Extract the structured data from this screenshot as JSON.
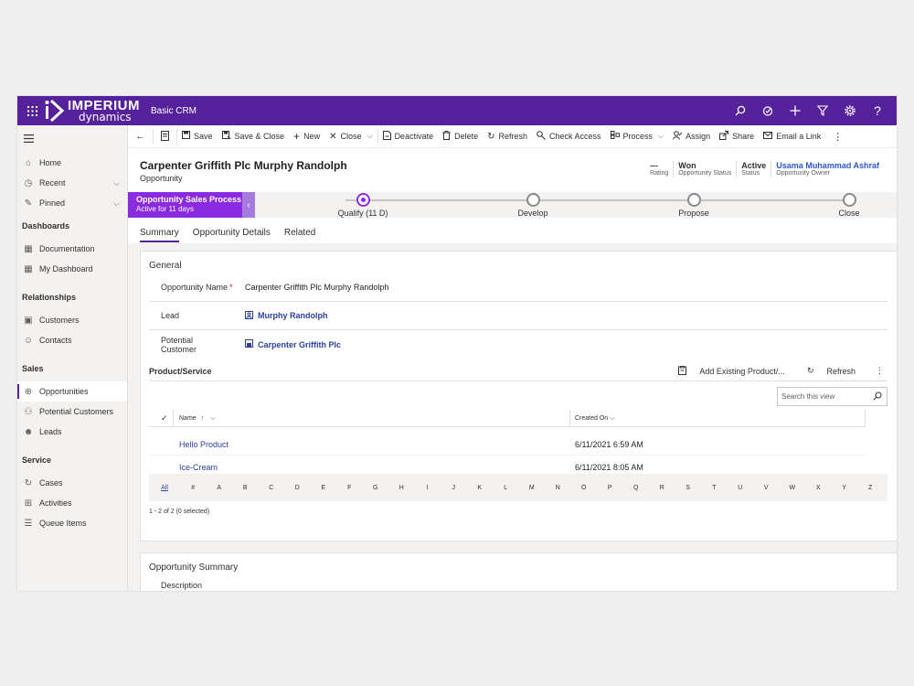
{
  "topbar": {
    "logo_line1": "IMPERIUM",
    "logo_line2": "dynamics",
    "app_name": "Basic CRM",
    "icons": [
      "search-icon",
      "task-icon",
      "plus-icon",
      "filter-icon",
      "gear-icon",
      "help-icon"
    ],
    "help_glyph": "?"
  },
  "sidebar": {
    "home": "Home",
    "recent": "Recent",
    "pinned": "Pinned",
    "sections": {
      "dashboards": "Dashboards",
      "relationships": "Relationships",
      "sales": "Sales",
      "service": "Service"
    },
    "dashboards_items": [
      "Documentation",
      "My Dashboard"
    ],
    "relationships_items": [
      "Customers",
      "Contacts"
    ],
    "sales_items": [
      "Opportunities",
      "Potential Customers",
      "Leads"
    ],
    "service_items": [
      "Cases",
      "Activities",
      "Queue Items"
    ]
  },
  "commands": {
    "save": "Save",
    "save_close": "Save & Close",
    "new": "New",
    "close": "Close",
    "deactivate": "Deactivate",
    "delete": "Delete",
    "refresh": "Refresh",
    "check_access": "Check Access",
    "process": "Process",
    "assign": "Assign",
    "share": "Share",
    "email_link": "Email a Link"
  },
  "record": {
    "title": "Carpenter Griffith Plc Murphy Randolph",
    "entity": "Opportunity",
    "header_fields": [
      {
        "value": "---",
        "label": "Rating"
      },
      {
        "value": "Won",
        "label": "Opportunity Status"
      },
      {
        "value": "Active",
        "label": "Status"
      },
      {
        "value": "Usama Muhammad Ashraf",
        "label": "Opportunity Owner"
      }
    ]
  },
  "process": {
    "name": "Opportunity Sales Process",
    "duration": "Active for 11 days",
    "stages": [
      "Qualify  (11 D)",
      "Develop",
      "Propose",
      "Close"
    ],
    "active_stage": 0
  },
  "tabs": [
    "Summary",
    "Opportunity Details",
    "Related"
  ],
  "general": {
    "title": "General",
    "fields": {
      "name_label": "Opportunity Name",
      "required_mark": "*",
      "name_value": "Carpenter Griffith Plc Murphy Randolph",
      "lead_label": "Lead",
      "lead_value": "Murphy Randolph",
      "customer_label": "Potential Customer",
      "customer_value": "Carpenter Griffith Plc"
    }
  },
  "products": {
    "title": "Product/Service",
    "add_existing": "Add Existing Product/...",
    "refresh": "Refresh",
    "search_placeholder": "Search this view",
    "col_name": "Name",
    "col_created": "Created On",
    "rows": [
      {
        "name": "Hello Product",
        "created": "6/11/2021 6:59 AM"
      },
      {
        "name": "Ice-Cream",
        "created": "6/11/2021 8:05 AM"
      }
    ],
    "alpha": [
      "All",
      "#",
      "A",
      "B",
      "C",
      "D",
      "E",
      "F",
      "G",
      "H",
      "I",
      "J",
      "K",
      "L",
      "M",
      "N",
      "O",
      "P",
      "Q",
      "R",
      "S",
      "T",
      "U",
      "V",
      "W",
      "X",
      "Y",
      "Z"
    ],
    "count": "1 - 2 of 2 (0 selected)"
  },
  "summary_section": {
    "title": "Opportunity Summary",
    "description_label": "Description"
  }
}
